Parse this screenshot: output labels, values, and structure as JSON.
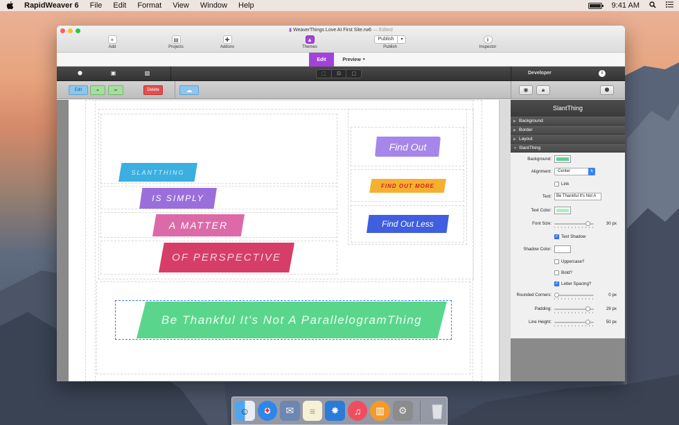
{
  "menubar": {
    "app_name": "RapidWeaver 6",
    "menus": [
      "File",
      "Edit",
      "Format",
      "View",
      "Window",
      "Help"
    ],
    "clock": "9:41 AM"
  },
  "window": {
    "title": "WeaverThings Love At First Site.rw6",
    "title_status": "— Edited"
  },
  "toolbar": {
    "add": "Add",
    "projects": "Projects",
    "addons": "Addons",
    "themes": "Themes",
    "publish_button": "Publish",
    "publish": "Publish",
    "inspector": "Inspector"
  },
  "tabs": {
    "edit": "Edit",
    "preview": "Preview"
  },
  "darkbar": {
    "developer": "Developer"
  },
  "graybar": {
    "edit": "Edit",
    "delete": "Delete"
  },
  "content": {
    "ribbons": [
      {
        "text": "SLANTTHING",
        "color": "#3aafe0"
      },
      {
        "text": "IS SIMPLY",
        "color": "#9a6fdc"
      },
      {
        "text": "A MATTER",
        "color": "#dc6aa8"
      },
      {
        "text": "OF PERSPECTIVE",
        "color": "#d63e68"
      }
    ],
    "buttons": [
      {
        "text": "Find Out",
        "color": "#a586ea",
        "text_color": "#ffffff"
      },
      {
        "text": "FIND OUT MORE",
        "color": "#f6b030",
        "text_color": "#d32020"
      },
      {
        "text": "Find Out Less",
        "color": "#3f5ee0",
        "text_color": "#ffffff"
      }
    ],
    "banner": {
      "text": "Be Thankful It's Not A ParallelogramThing",
      "color": "#5ad68c"
    }
  },
  "inspector": {
    "title": "SlantThing",
    "sections": [
      "Background",
      "Border",
      "Layout",
      "SlantThing"
    ],
    "background_label": "Background:",
    "background_color": "#5ed194",
    "alignment_label": "Alignment:",
    "alignment_value": "Center",
    "link_label": "Link",
    "text_label": "Text:",
    "text_value": "Be Thankful It's Not A",
    "text_color_label": "Text Color:",
    "text_color": "#a7f0c4",
    "font_size_label": "Font Size:",
    "font_size_value": "30 px",
    "font_size_fraction": 0.9,
    "text_shadow_label": "Text Shadow",
    "shadow_color_label": "Shadow Color:",
    "shadow_color": "#ffffff",
    "uppercase_label": "Uppercase?",
    "bold_label": "Bold?",
    "letter_spacing_label": "Letter Spacing?",
    "rounded_corners_label": "Rounded Corners:",
    "rounded_corners_value": "0 px",
    "rounded_corners_fraction": 0,
    "padding_label": "Padding:",
    "padding_value": "29 px",
    "padding_fraction": 0.9,
    "line_height_label": "Line Height:",
    "line_height_value": "50 px",
    "line_height_fraction": 0.9
  }
}
